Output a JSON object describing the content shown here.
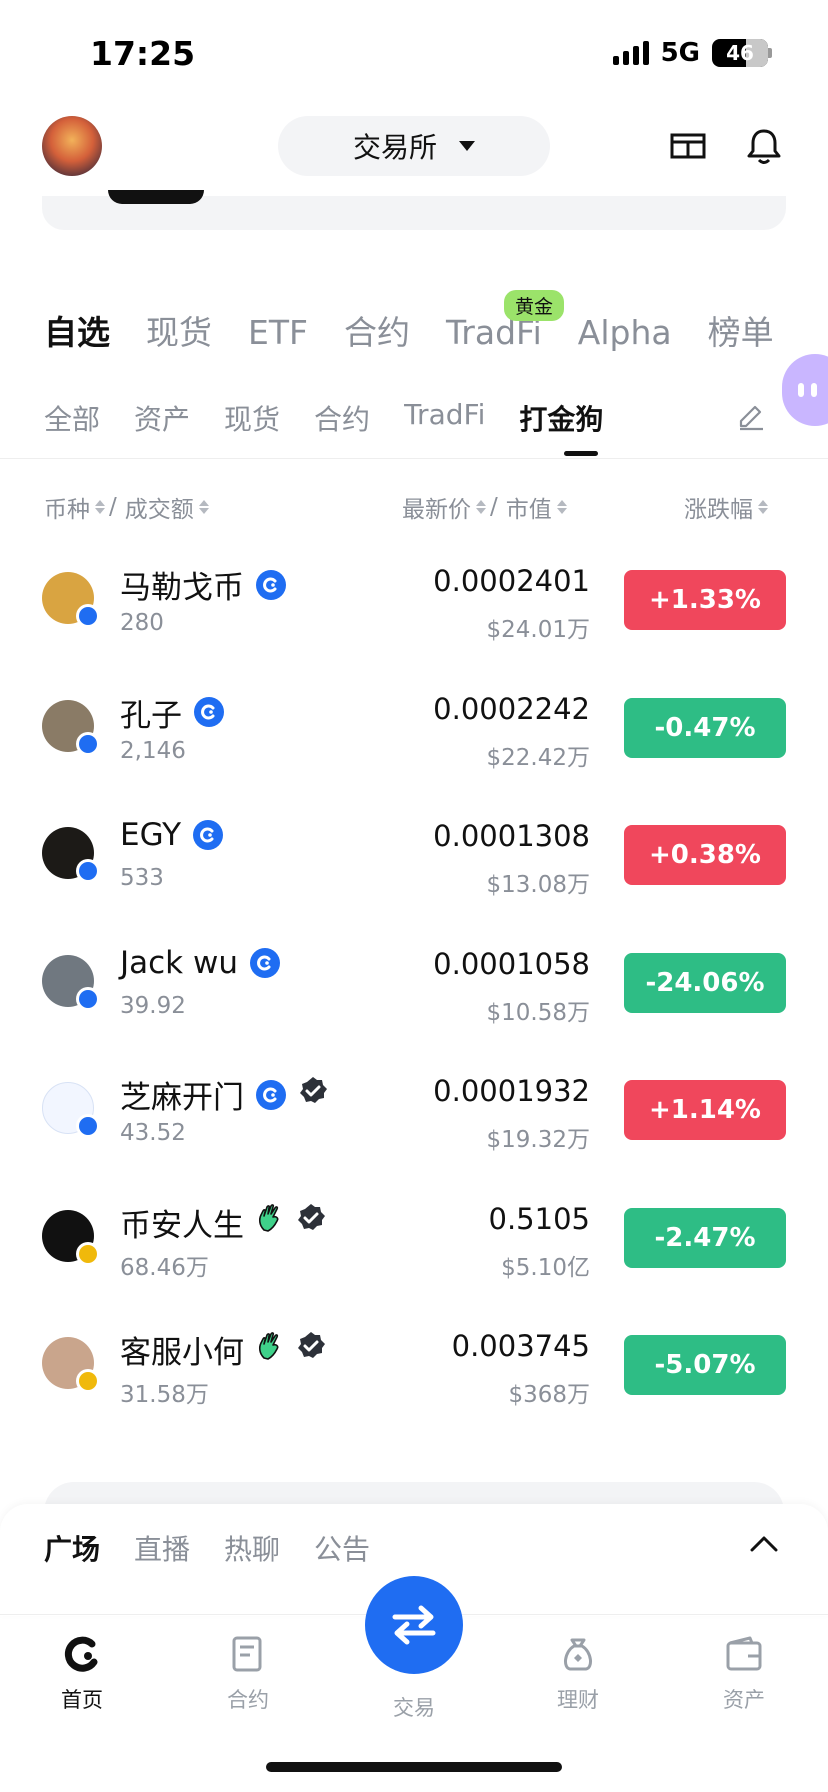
{
  "status_bar": {
    "time": "17:25",
    "network": "5G",
    "battery": "46"
  },
  "header": {
    "exchange_label": "交易所"
  },
  "primary_tabs": [
    {
      "label": "自选",
      "active": true
    },
    {
      "label": "现货"
    },
    {
      "label": "ETF"
    },
    {
      "label": "合约"
    },
    {
      "label": "TradFi",
      "badge": "黄金"
    },
    {
      "label": "Alpha"
    },
    {
      "label": "榜单"
    }
  ],
  "secondary_tabs": [
    {
      "label": "全部"
    },
    {
      "label": "资产"
    },
    {
      "label": "现货"
    },
    {
      "label": "合约"
    },
    {
      "label": "TradFi"
    },
    {
      "label": "打金狗",
      "active": true
    }
  ],
  "columns": {
    "coin": "币种",
    "volume": "成交额",
    "price": "最新价",
    "mcap": "市值",
    "change": "涨跌幅",
    "sep": "/"
  },
  "rows": [
    {
      "name": "马勒戈币",
      "volume": "280",
      "price": "0.0002401",
      "mcap": "$24.01万",
      "change": "+1.33%",
      "direction": "up",
      "avatar_color": "#d9a441",
      "badge": "c"
    },
    {
      "name": "孔子",
      "volume": "2,146",
      "price": "0.0002242",
      "mcap": "$22.42万",
      "change": "-0.47%",
      "direction": "down",
      "avatar_color": "#8a7b66",
      "badge": "c"
    },
    {
      "name": "EGY",
      "volume": "533",
      "price": "0.0001308",
      "mcap": "$13.08万",
      "change": "+0.38%",
      "direction": "up",
      "avatar_color": "#1c1a17",
      "badge": "c"
    },
    {
      "name": "Jack wu",
      "volume": "39.92",
      "price": "0.0001058",
      "mcap": "$10.58万",
      "change": "-24.06%",
      "direction": "down",
      "avatar_color": "#707880",
      "badge": "c"
    },
    {
      "name": "芝麻开门",
      "volume": "43.52",
      "price": "0.0001932",
      "mcap": "$19.32万",
      "change": "+1.14%",
      "direction": "up",
      "avatar_color": "#f2f6ff",
      "badge": "c"
    },
    {
      "name": "币安人生",
      "volume": "68.46万",
      "price": "0.5105",
      "mcap": "$5.10亿",
      "change": "-2.47%",
      "direction": "down",
      "avatar_color": "#111111",
      "badge": "bnb"
    },
    {
      "name": "客服小何",
      "volume": "31.58万",
      "price": "0.003745",
      "mcap": "$368万",
      "change": "-5.07%",
      "direction": "down",
      "avatar_color": "#c9a58c",
      "badge": "bnb"
    }
  ],
  "feed_tabs": [
    {
      "label": "广场",
      "active": true
    },
    {
      "label": "直播"
    },
    {
      "label": "热聊"
    },
    {
      "label": "公告"
    }
  ],
  "bottom_nav": {
    "home": "首页",
    "futures": "合约",
    "trade": "交易",
    "earn": "理财",
    "assets": "资产"
  },
  "colors": {
    "up": "#f0475c",
    "down": "#2ebd85",
    "accent": "#1f6df2",
    "muted": "#8a8f98",
    "gold_badge": "#9be36a"
  }
}
